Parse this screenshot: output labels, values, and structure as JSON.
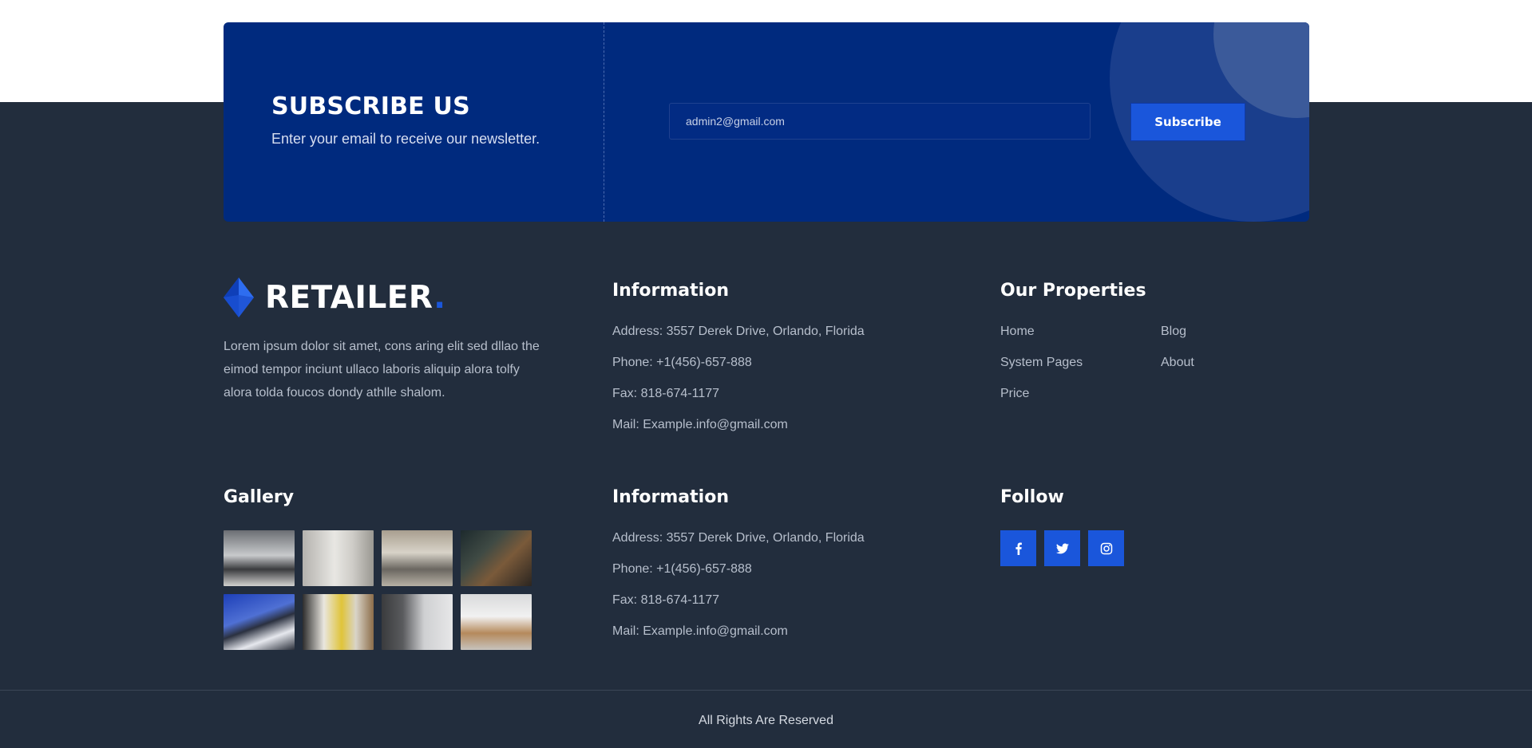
{
  "subscribe": {
    "title": "SUBSCRIBE US",
    "text": "Enter your email to receive our newsletter.",
    "email_value": "admin2@gmail.com",
    "button_label": "Subscribe"
  },
  "brand": {
    "name": "RETAILER",
    "dot": ".",
    "description": "Lorem ipsum dolor sit amet, cons aring elit sed dllao the eimod tempor inciunt ullaco laboris aliquip alora tolfy alora tolda foucos dondy athlle shalom."
  },
  "information_1": {
    "title": "Information",
    "items": [
      "Address: 3557 Derek Drive, Orlando, Florida",
      "Phone: +1(456)-657-888",
      "Fax: 818-674-1177",
      "Mail: Example.info@gmail.com"
    ]
  },
  "properties": {
    "title": "Our Properties",
    "links": [
      "Home",
      "Blog",
      "System Pages",
      "About",
      "Price"
    ]
  },
  "gallery": {
    "title": "Gallery",
    "images": [
      "living-room",
      "bedroom-mirror",
      "lounge",
      "dining-room",
      "building-facade",
      "yellow-chair-room",
      "kitchen",
      "dining-table"
    ]
  },
  "information_2": {
    "title": "Information",
    "items": [
      "Address: 3557 Derek Drive, Orlando, Florida",
      "Phone: +1(456)-657-888",
      "Fax: 818-674-1177",
      "Mail: Example.info@gmail.com"
    ]
  },
  "follow": {
    "title": "Follow",
    "icons": [
      "facebook-icon",
      "twitter-icon",
      "instagram-icon"
    ]
  },
  "footer": {
    "copyright": "All Rights Are Reserved"
  },
  "colors": {
    "background": "#222d3d",
    "banner": "#002a7e",
    "accent": "#1a56db",
    "muted_text": "#b7bfcc"
  }
}
